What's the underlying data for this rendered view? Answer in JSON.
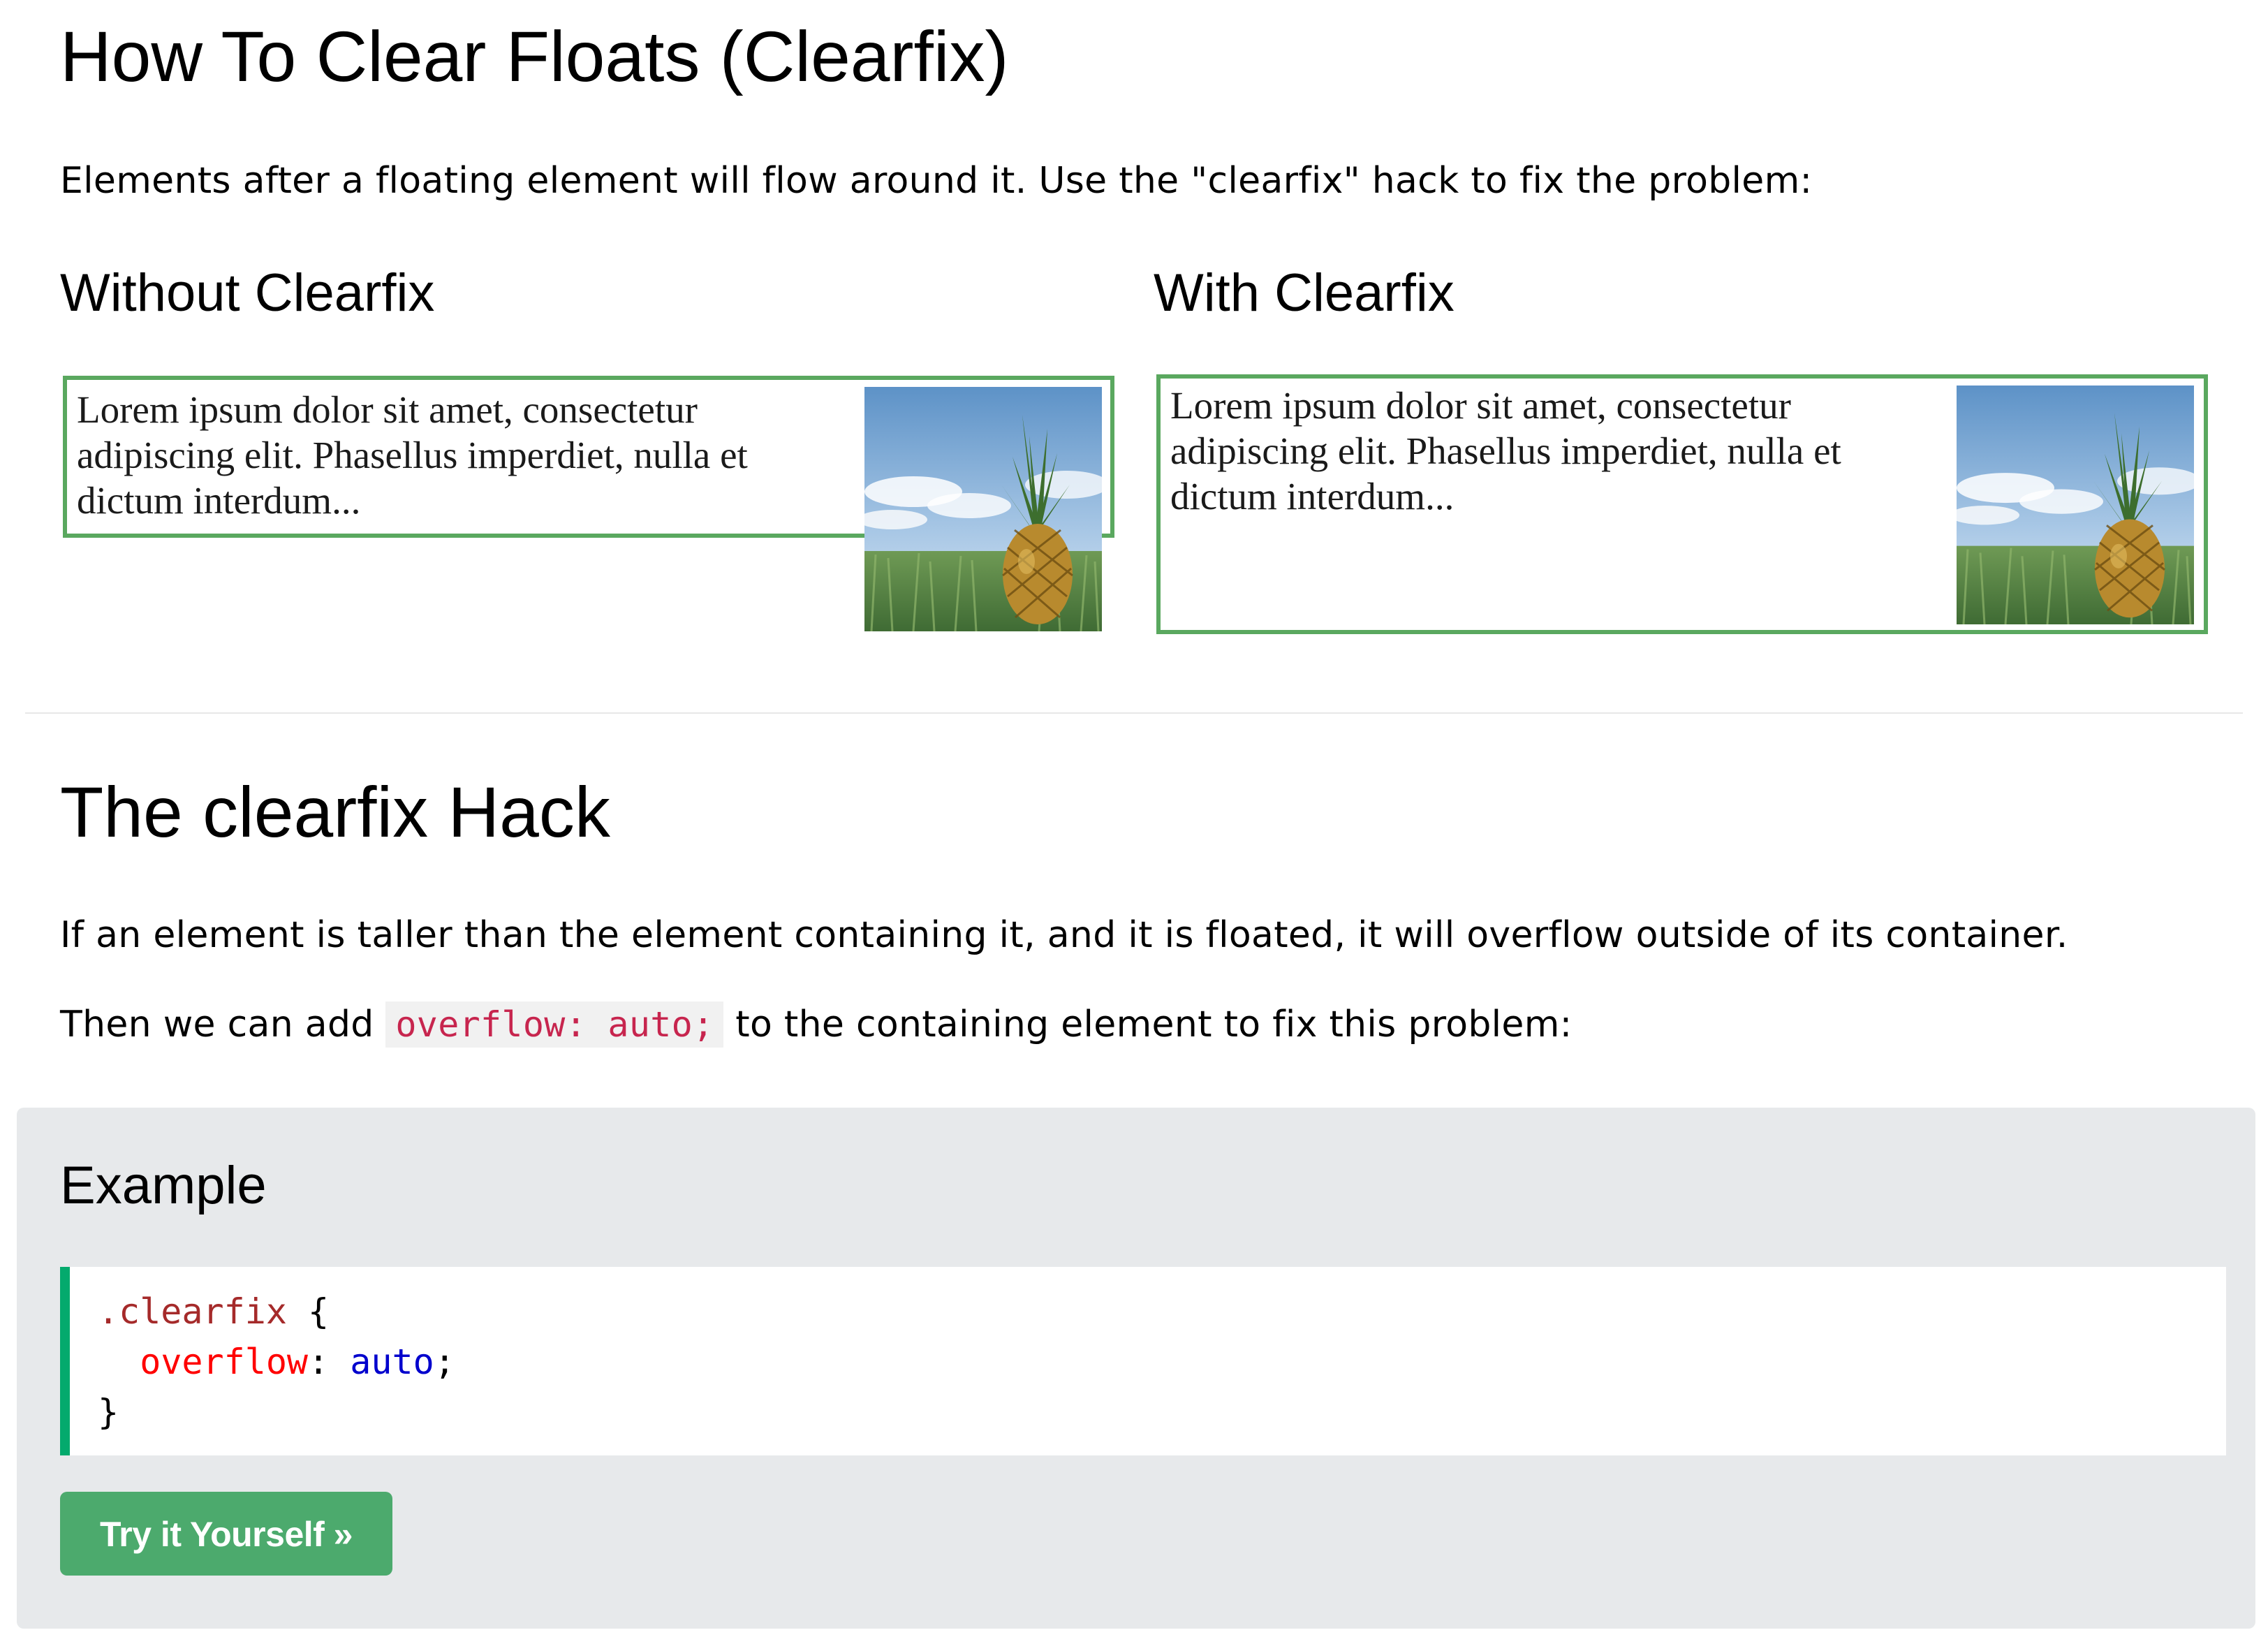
{
  "page": {
    "title": "How To Clear Floats (Clearfix)",
    "intro": "Elements after a floating element will flow around it. Use the \"clearfix\" hack to fix the problem:"
  },
  "demos": [
    {
      "heading": "Without Clearfix",
      "lines": [
        "Lorem ipsum dolor sit amet, consectetur",
        "adipiscing elit. Phasellus imperdiet, nulla et",
        "dictum interdum..."
      ]
    },
    {
      "heading": "With Clearfix",
      "lines": [
        "Lorem ipsum dolor sit amet, consectetur",
        "adipiscing elit. Phasellus imperdiet, nulla et",
        "dictum interdum..."
      ]
    }
  ],
  "hack": {
    "title": "The clearfix Hack",
    "para1": "If an element is taller than the element containing it, and it is floated, it will overflow outside of its container.",
    "para2_before": "Then we can add ",
    "para2_code": "overflow: auto;",
    "para2_after": " to the containing element to fix this problem:"
  },
  "example": {
    "title": "Example",
    "code": {
      "selector": ".clearfix",
      "open": " {",
      "property": "overflow",
      "colon": ": ",
      "value": "auto",
      "semicolon": ";",
      "close": "}"
    },
    "button_label": "Try it Yourself »"
  },
  "icons": {
    "pineapple_image": "pineapple-photo"
  },
  "colors": {
    "demo_border": "#5aa85f",
    "code_accent": "#04aa6d",
    "button_bg": "#4caa6d",
    "panel_bg": "#e7e9eb",
    "inline_code": "#c7254e"
  }
}
